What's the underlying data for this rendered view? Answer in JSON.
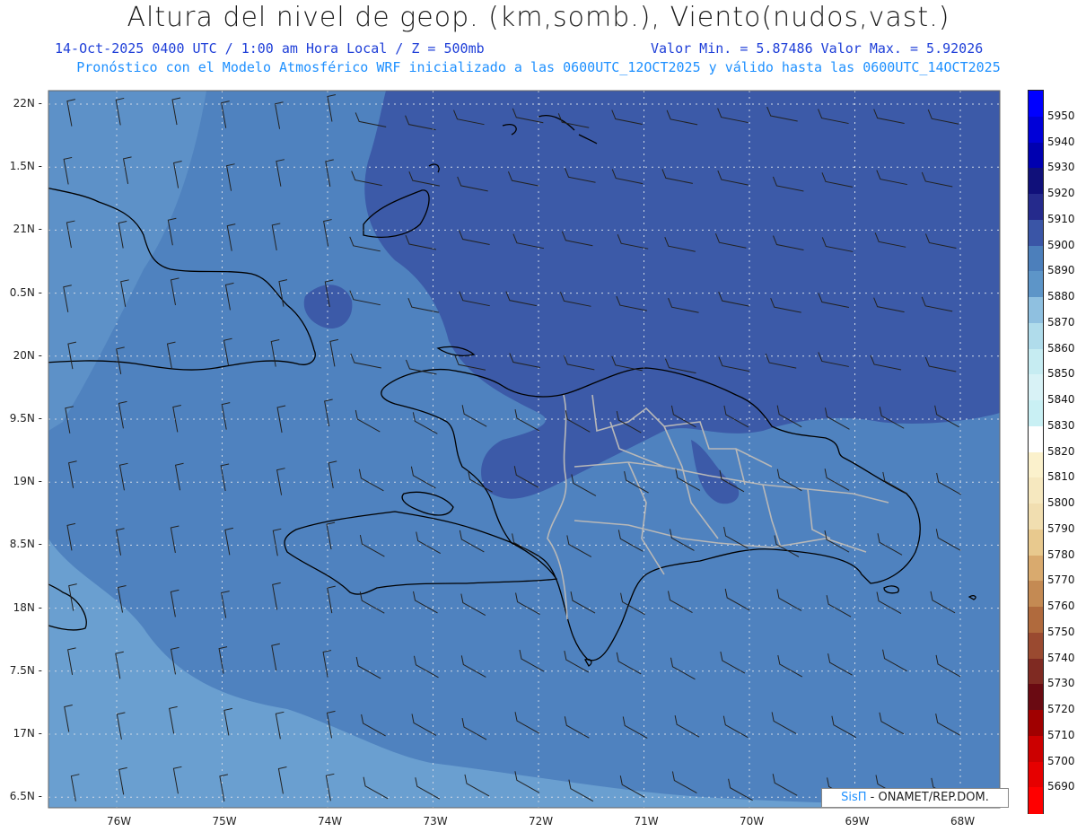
{
  "title": "Altura del nivel de geop. (km,somb.), Viento(nudos,vast.)",
  "subtitle_left": "14-Oct-2025  0400 UTC / 1:00 am Hora Local / Z = 500mb",
  "subtitle_right": "Valor Min. = 5.87486  Valor Max. = 5.92026",
  "subtitle2": "Pronóstico con el Modelo Atmosférico WRF inicializado a las 0600UTC_12OCT2025 y válido hasta las  0600UTC_14OCT2025",
  "credit_logo": "SisΠ",
  "credit_text": " - ONAMET/REP.DOM.",
  "lat_labels": [
    "22N",
    "1.5N",
    "21N",
    "0.5N",
    "20N",
    "9.5N",
    "19N",
    "8.5N",
    "18N",
    "7.5N",
    "17N",
    "6.5N"
  ],
  "lon_labels": [
    "76W",
    "75W",
    "74W",
    "73W",
    "72W",
    "71W",
    "70W",
    "69W",
    "68W"
  ],
  "colorbar": {
    "labels": [
      "5950",
      "5940",
      "5930",
      "5920",
      "5910",
      "5900",
      "5890",
      "5880",
      "5870",
      "5860",
      "5850",
      "5840",
      "5830",
      "5820",
      "5810",
      "5800",
      "5790",
      "5780",
      "5770",
      "5760",
      "5750",
      "5740",
      "5730",
      "5720",
      "5710",
      "5700",
      "5690"
    ],
    "colors": [
      "#0000ff",
      "#0000d8",
      "#0000b0",
      "#10107a",
      "#252a8c",
      "#3a55a6",
      "#4c7fbb",
      "#5d95c8",
      "#8fc0e0",
      "#b0dceb",
      "#c6ecf2",
      "#d8f2f6",
      "#c9f0f4",
      "#ffffff",
      "#fbf1cc",
      "#f6e8bf",
      "#f1deb0",
      "#e8c98e",
      "#d9aa6e",
      "#c48a53",
      "#b06a3d",
      "#9a4a30",
      "#7f2a22",
      "#6a0a12",
      "#a00000",
      "#cc0000",
      "#e60000",
      "#ff0000"
    ]
  },
  "shading_colors": {
    "light": "#6a9fd0",
    "mid": "#4f82bf",
    "dark": "#3c5aa8"
  }
}
